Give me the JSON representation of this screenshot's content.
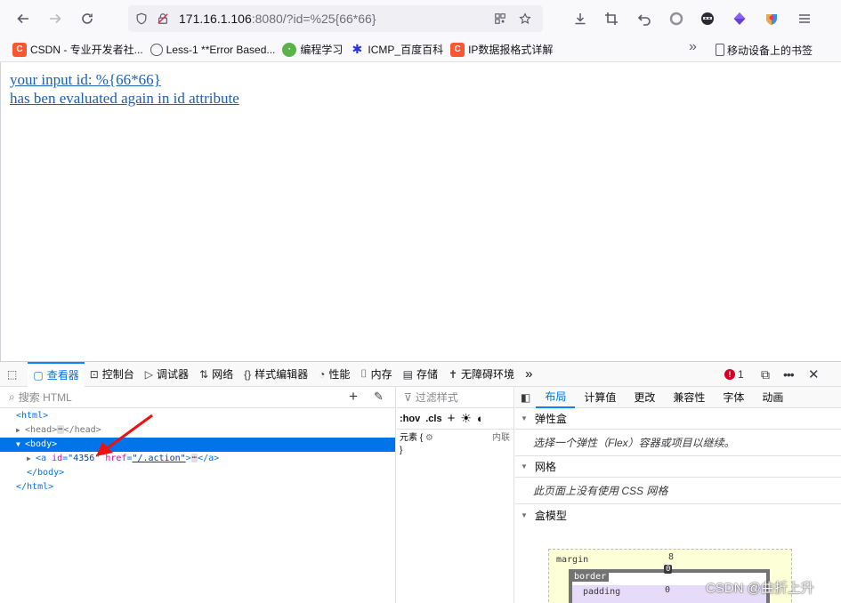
{
  "browser": {
    "url_host": "171.16.1.106",
    "url_rest": ":8080/?id=%25{66*66}"
  },
  "bookmarks": [
    {
      "label": "CSDN - 专业开发者社...",
      "icon": "csdn-icon"
    },
    {
      "label": "Less-1 **Error Based...",
      "icon": "globe-icon"
    },
    {
      "label": "编程学习",
      "icon": "learn-icon"
    },
    {
      "label": "ICMP_百度百科",
      "icon": "baidu-icon"
    },
    {
      "label": "IP数据报格式详解",
      "icon": "csdn-icon"
    }
  ],
  "bookmarks_mobile": "移动设备上的书签",
  "page": {
    "line1": "your input id: %{66*66}",
    "line2": "has ben evaluated again in id attribute"
  },
  "devtools": {
    "tabs": [
      {
        "label": "查看器",
        "icon": "inspector-icon"
      },
      {
        "label": "控制台",
        "icon": "console-icon"
      },
      {
        "label": "调试器",
        "icon": "debugger-icon"
      },
      {
        "label": "网络",
        "icon": "network-icon"
      },
      {
        "label": "样式编辑器",
        "icon": "style-editor-icon"
      },
      {
        "label": "性能",
        "icon": "performance-icon"
      },
      {
        "label": "内存",
        "icon": "memory-icon"
      },
      {
        "label": "存储",
        "icon": "storage-icon"
      },
      {
        "label": "无障碍环境",
        "icon": "accessibility-icon"
      }
    ],
    "error_count": "1",
    "search_placeholder": "搜索 HTML",
    "tree": {
      "html_open": "<html>",
      "head_open": "<head>",
      "head_close": "</head>",
      "body_open": "<body>",
      "a_open": "<a",
      "a_id_name": "id",
      "a_id_value": "\"4356\"",
      "a_href_name": "href",
      "a_href_value": "\"/.action\"",
      "a_tag_end": ">",
      "a_close": "</a>",
      "body_close": "</body>",
      "html_close": "</html>",
      "ellipsis": "⋯"
    },
    "rules": {
      "filter_placeholder": "过滤样式",
      "hov": ":hov",
      "cls": ".cls",
      "element_rule": "元素 {",
      "close_brace": "}",
      "inline_label": "内联"
    },
    "layout": {
      "tabs": [
        "布局",
        "计算值",
        "更改",
        "兼容性",
        "字体",
        "动画"
      ],
      "flex_title": "弹性盒",
      "flex_body": "选择一个弹性（Flex）容器或项目以继续。",
      "grid_title": "网格",
      "grid_body": "此页面上没有使用 CSS 网格",
      "boxmodel_title": "盒模型",
      "margin_label": "margin",
      "margin_value": "8",
      "border_label": "border",
      "border_value": "0",
      "padding_label": "padding",
      "padding_value": "0"
    }
  },
  "watermark": "CSDN @曲折上升"
}
